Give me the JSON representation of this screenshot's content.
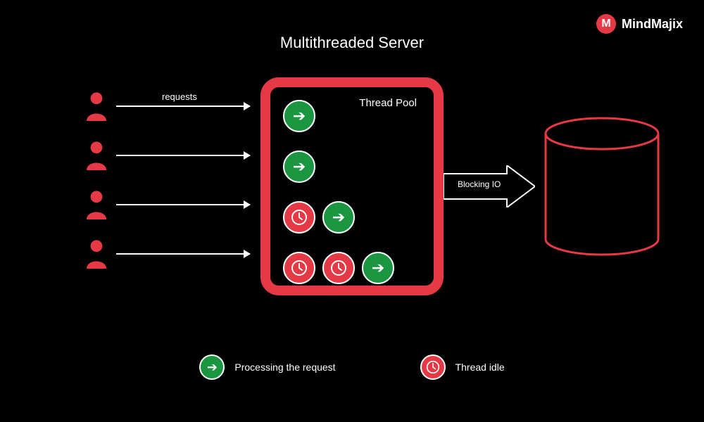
{
  "brand": {
    "name": "MindMajix",
    "mark": "M"
  },
  "title": "Multithreaded Server",
  "requestsLabel": "requests",
  "pool": {
    "title": "Thread Pool",
    "rows": [
      {
        "icons": [
          "arrow"
        ]
      },
      {
        "icons": [
          "arrow"
        ]
      },
      {
        "icons": [
          "clock",
          "arrow"
        ]
      },
      {
        "icons": [
          "clock",
          "clock",
          "arrow"
        ]
      }
    ]
  },
  "blockingLabel": "Blocking IO",
  "legend": {
    "processing": "Processing the request",
    "idle": "Thread idle"
  },
  "colors": {
    "accent": "#e63946",
    "green": "#1a9641"
  }
}
